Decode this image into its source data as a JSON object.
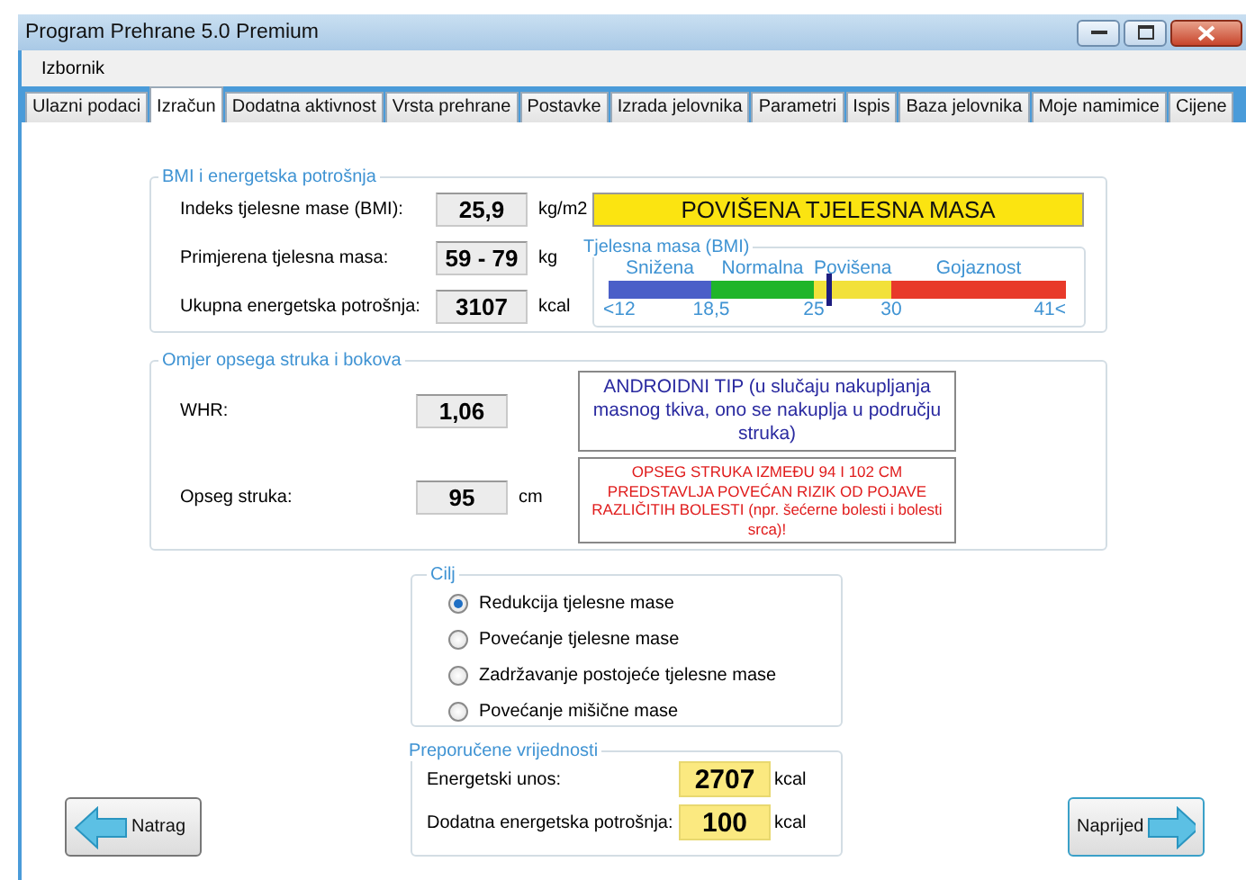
{
  "window": {
    "title": "Program Prehrane 5.0 Premium"
  },
  "menu": [
    "Izbornik"
  ],
  "tabs": [
    {
      "label": "Ulazni podaci",
      "selected": false
    },
    {
      "label": "Izračun",
      "selected": true
    },
    {
      "label": "Dodatna aktivnost",
      "selected": false
    },
    {
      "label": "Vrsta prehrane",
      "selected": false
    },
    {
      "label": "Postavke",
      "selected": false
    },
    {
      "label": "Izrada jelovnika",
      "selected": false
    },
    {
      "label": "Parametri",
      "selected": false
    },
    {
      "label": "Ispis",
      "selected": false
    },
    {
      "label": "Baza jelovnika",
      "selected": false
    },
    {
      "label": "Moje namimice",
      "selected": false
    },
    {
      "label": "Cijene",
      "selected": false
    }
  ],
  "bmi_group": {
    "title": "BMI i energetska potrošnja",
    "rows": [
      {
        "label": "Indeks tjelesne mase (BMI):",
        "value": "25,9",
        "unit": "kg/m2"
      },
      {
        "label": "Primjerena tjelesna masa:",
        "value": "59 - 79",
        "unit": "kg"
      },
      {
        "label": "Ukupna energetska potrošnja:",
        "value": "3107",
        "unit": "kcal"
      }
    ],
    "status": "POVIŠENA TJELESNA MASA",
    "scale": {
      "title": "Tjelesna masa (BMI)",
      "segments": [
        {
          "label": "Snižena",
          "color": "#4a5fc8"
        },
        {
          "label": "Normalna",
          "color": "#1fb52a"
        },
        {
          "label": "Povišena",
          "color": "#f2e13a"
        },
        {
          "label": "Gojaznost",
          "color": "#e83a2a"
        }
      ],
      "ticks": [
        "<12",
        "18,5",
        "25",
        "30",
        "41<"
      ],
      "level": 0.48
    }
  },
  "waist_group": {
    "title": "Omjer opsega struka i bokova",
    "rows": [
      {
        "label": "WHR:",
        "value": "1,06"
      },
      {
        "label": "Opseg struka:",
        "value": "95",
        "unit": "cm"
      }
    ],
    "type_note": "ANDROIDNI TIP (u slučaju nakupljanja masnog tkiva, ono se nakuplja u području struka)",
    "warning": "OPSEG STRUKA IZMEĐU 94 I 102 CM PREDSTAVLJA POVEĆAN RIZIK OD POJAVE RAZLIČITIH BOLESTI (npr. šećerne bolesti i bolesti srca)!"
  },
  "goal_group": {
    "title": "Cilj",
    "options": [
      {
        "label": "Redukcija tjelesne mase",
        "selected": true
      },
      {
        "label": "Povećanje tjelesne mase",
        "selected": false
      },
      {
        "label": "Zadržavanje postojeće tjelesne mase",
        "selected": false
      },
      {
        "label": "Povećanje mišične mase",
        "selected": false
      }
    ]
  },
  "recommended_group": {
    "title": "Preporučene vrijednosti",
    "rows": [
      {
        "label": "Energetski unos:",
        "value": "2707",
        "unit": "kcal"
      },
      {
        "label": "Dodatna energetska potrošnja:",
        "value": "100",
        "unit": "kcal"
      }
    ]
  },
  "buttons": {
    "back": "Natrag",
    "next": "Naprijed"
  }
}
